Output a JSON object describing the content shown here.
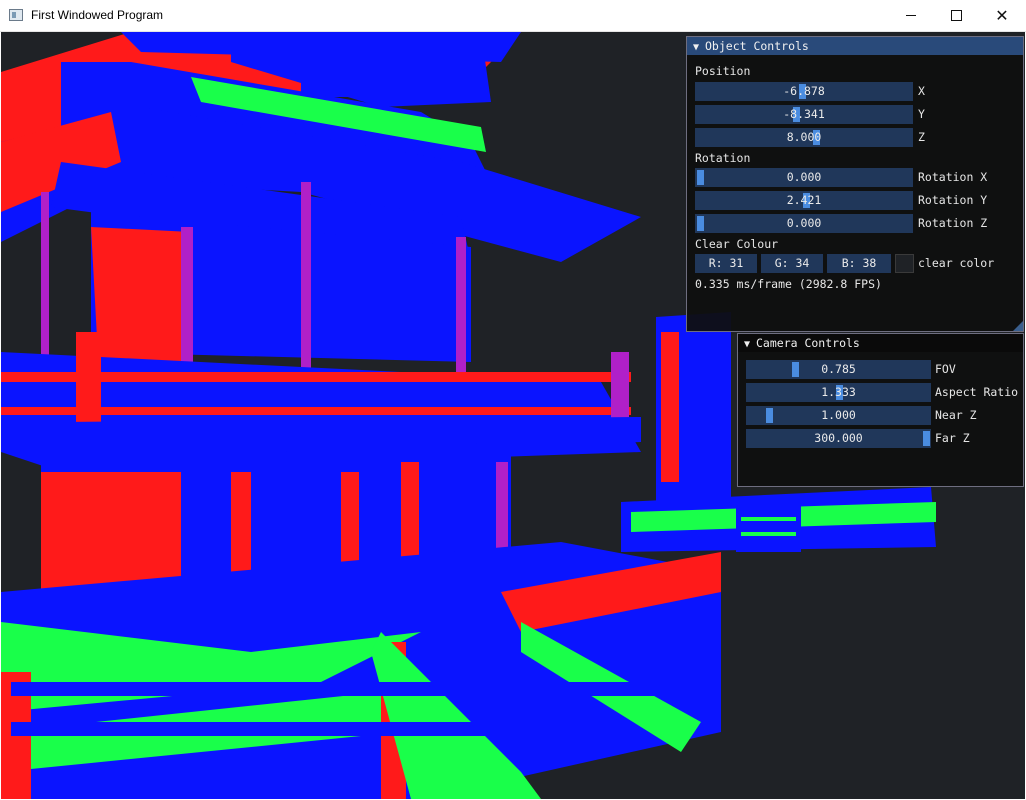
{
  "window": {
    "title": "First Windowed Program",
    "minimize_icon": "minimize-icon",
    "maximize_icon": "maximize-icon",
    "close_glyph": "✕"
  },
  "scene": {
    "clear_color": "#1f2226",
    "palette": {
      "red": "#ff1a1a",
      "blue": "#0a14ff",
      "green": "#19ff4a",
      "magenta": "#b020c8"
    }
  },
  "object_controls": {
    "title": "Object Controls",
    "position_label": "Position",
    "position": [
      {
        "value": "-6.878",
        "axis": "X",
        "fraction": 0.49
      },
      {
        "value": "-8.341",
        "axis": "Y",
        "fraction": 0.46
      },
      {
        "value": "8.000",
        "axis": "Z",
        "fraction": 0.56
      }
    ],
    "rotation_label": "Rotation",
    "rotation": [
      {
        "value": "0.000",
        "axis": "Rotation X",
        "fraction": 0.0
      },
      {
        "value": "2.421",
        "axis": "Rotation Y",
        "fraction": 0.51
      },
      {
        "value": "0.000",
        "axis": "Rotation Z",
        "fraction": 0.0
      }
    ],
    "clear_colour_label": "Clear Colour",
    "colour": {
      "r": "R: 31",
      "g": "G: 34",
      "b": "B: 38",
      "swatch": "#1f2226",
      "label": "clear color"
    },
    "fps_text": "0.335 ms/frame (2982.8 FPS)"
  },
  "camera_controls": {
    "title": "Camera Controls",
    "rows": [
      {
        "value": "0.785",
        "label": "FOV",
        "fraction": 0.25
      },
      {
        "value": "1.333",
        "label": "Aspect Ratio",
        "fraction": 0.5
      },
      {
        "value": "1.000",
        "label": "Near Z",
        "fraction": 0.1
      },
      {
        "value": "300.000",
        "label": "Far Z",
        "fraction": 1.0
      }
    ]
  }
}
